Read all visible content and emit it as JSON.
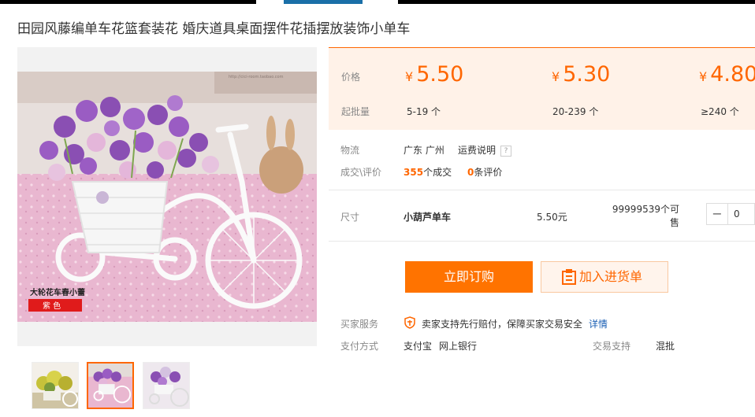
{
  "title": "田园风藤编单车花篮套装花 婚庆道具桌面摆件花插摆放装饰小单车",
  "image": {
    "caption_line1": "大轮花车春小蕾",
    "caption_line2": "紫 色",
    "watermark": "http://cici-room.taobao.com"
  },
  "pricing": {
    "price_label": "价格",
    "qty_label": "起批量",
    "currency": "¥",
    "tiers": [
      {
        "price": "5.50",
        "qty": "5-19 个"
      },
      {
        "price": "5.30",
        "qty": "20-239 个"
      },
      {
        "price": "4.80",
        "qty": "≥240 个"
      }
    ]
  },
  "logistics": {
    "label": "物流",
    "location": "广东 广州",
    "shipping_link": "运费说明",
    "help": "?"
  },
  "deals": {
    "label": "成交\\评价",
    "count": "355",
    "count_suffix": "个成交",
    "reviews": "0",
    "reviews_suffix": "条评价"
  },
  "sku": {
    "label": "尺寸",
    "name": "小葫芦单车",
    "price": "5.50元",
    "stock": "99999539个可售",
    "qty_value": "0",
    "minus": "−"
  },
  "actions": {
    "buy_label": "立即订购",
    "cart_label": "加入进货单"
  },
  "services": {
    "label": "买家服务",
    "text": "卖家支持先行赔付，保障买家交易安全",
    "details_link": "详情",
    "payment_label": "支付方式",
    "payment_methods": [
      "支付宝",
      "网上银行"
    ],
    "trade_label": "交易支持",
    "trade_value": "混批"
  },
  "colors": {
    "accent": "#ff7300",
    "price": "#ff6600",
    "link": "#1a5fb4",
    "price_bg": "#fff2e8"
  }
}
